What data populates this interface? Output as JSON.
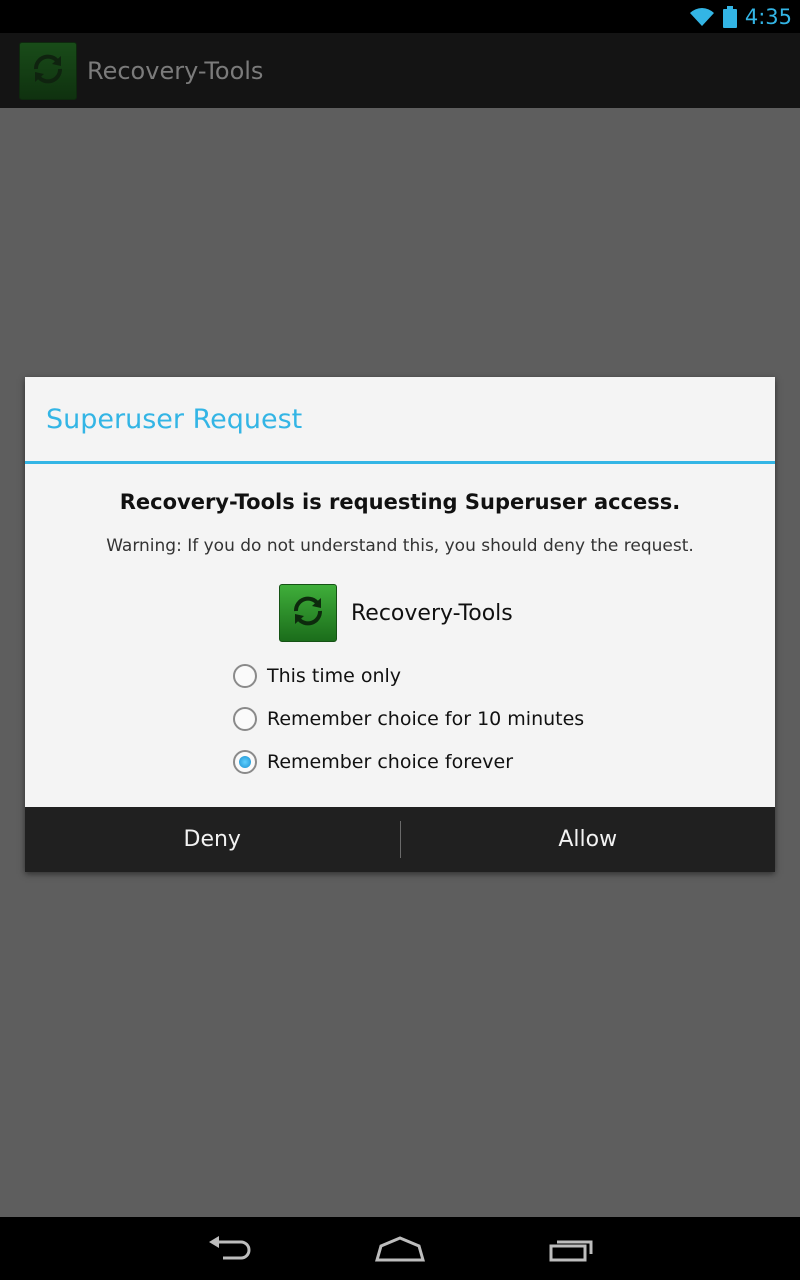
{
  "status_bar": {
    "time": "4:35",
    "icons": [
      "wifi-icon",
      "battery-icon"
    ],
    "accent_color": "#33b5e5"
  },
  "action_bar": {
    "title": "Recovery-Tools",
    "icon": "refresh-icon"
  },
  "dialog": {
    "title": "Superuser Request",
    "request_text": "Recovery-Tools is requesting Superuser access.",
    "warning": "Warning: If you do not understand this, you should deny the request.",
    "app_name": "Recovery-Tools",
    "options": [
      {
        "label": "This time only",
        "selected": false
      },
      {
        "label": "Remember choice for 10 minutes",
        "selected": false
      },
      {
        "label": "Remember choice forever",
        "selected": true
      }
    ],
    "deny_label": "Deny",
    "allow_label": "Allow",
    "accent_color": "#33b5e5"
  },
  "nav_bar": {
    "icons": [
      "back-icon",
      "home-icon",
      "recent-apps-icon"
    ]
  }
}
